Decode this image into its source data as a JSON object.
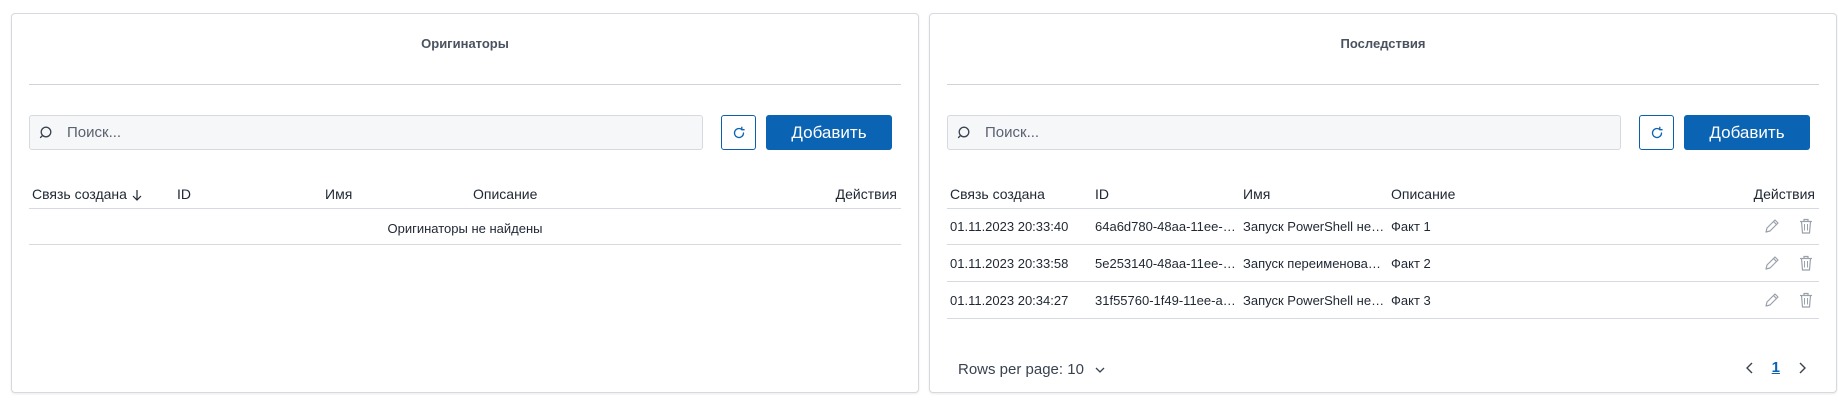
{
  "originators": {
    "title": "Оригинаторы",
    "search_placeholder": "Поиск...",
    "add_label": "Добавить",
    "columns": [
      "Связь создана",
      "ID",
      "Имя",
      "Описание",
      "Действия"
    ],
    "empty_text": "Оригинаторы не найдены"
  },
  "consequences": {
    "title": "Последствия",
    "search_placeholder": "Поиск...",
    "add_label": "Добавить",
    "columns": [
      "Связь создана",
      "ID",
      "Имя",
      "Описание",
      "Действия"
    ],
    "rows": [
      {
        "created": "01.11.2023 20:33:40",
        "id": "64a6d780-48aa-11ee-8bd...",
        "name": "Запуск PowerShell не чер...",
        "description": "Факт 1"
      },
      {
        "created": "01.11.2023 20:33:58",
        "id": "5e253140-48aa-11ee-8bd...",
        "name": "Запуск переименованно...",
        "description": "Факт 2"
      },
      {
        "created": "01.11.2023 20:34:27",
        "id": "31f55760-1f49-11ee-a272...",
        "name": "Запуск PowerShell не чер...",
        "description": "Факт 3"
      }
    ],
    "rows_per_page_label": "Rows per page: 10",
    "current_page": "1"
  },
  "icons": {
    "search": "search-icon",
    "refresh": "refresh-icon",
    "sort": "arrow-down-icon",
    "edit": "pencil-icon",
    "delete": "trash-icon",
    "chevron_down": "chevron-down-icon",
    "prev": "chevron-left-icon",
    "next": "chevron-right-icon"
  },
  "colors": {
    "primary": "#0b63b3",
    "border": "#d6d9de",
    "title": "#4a5260"
  }
}
